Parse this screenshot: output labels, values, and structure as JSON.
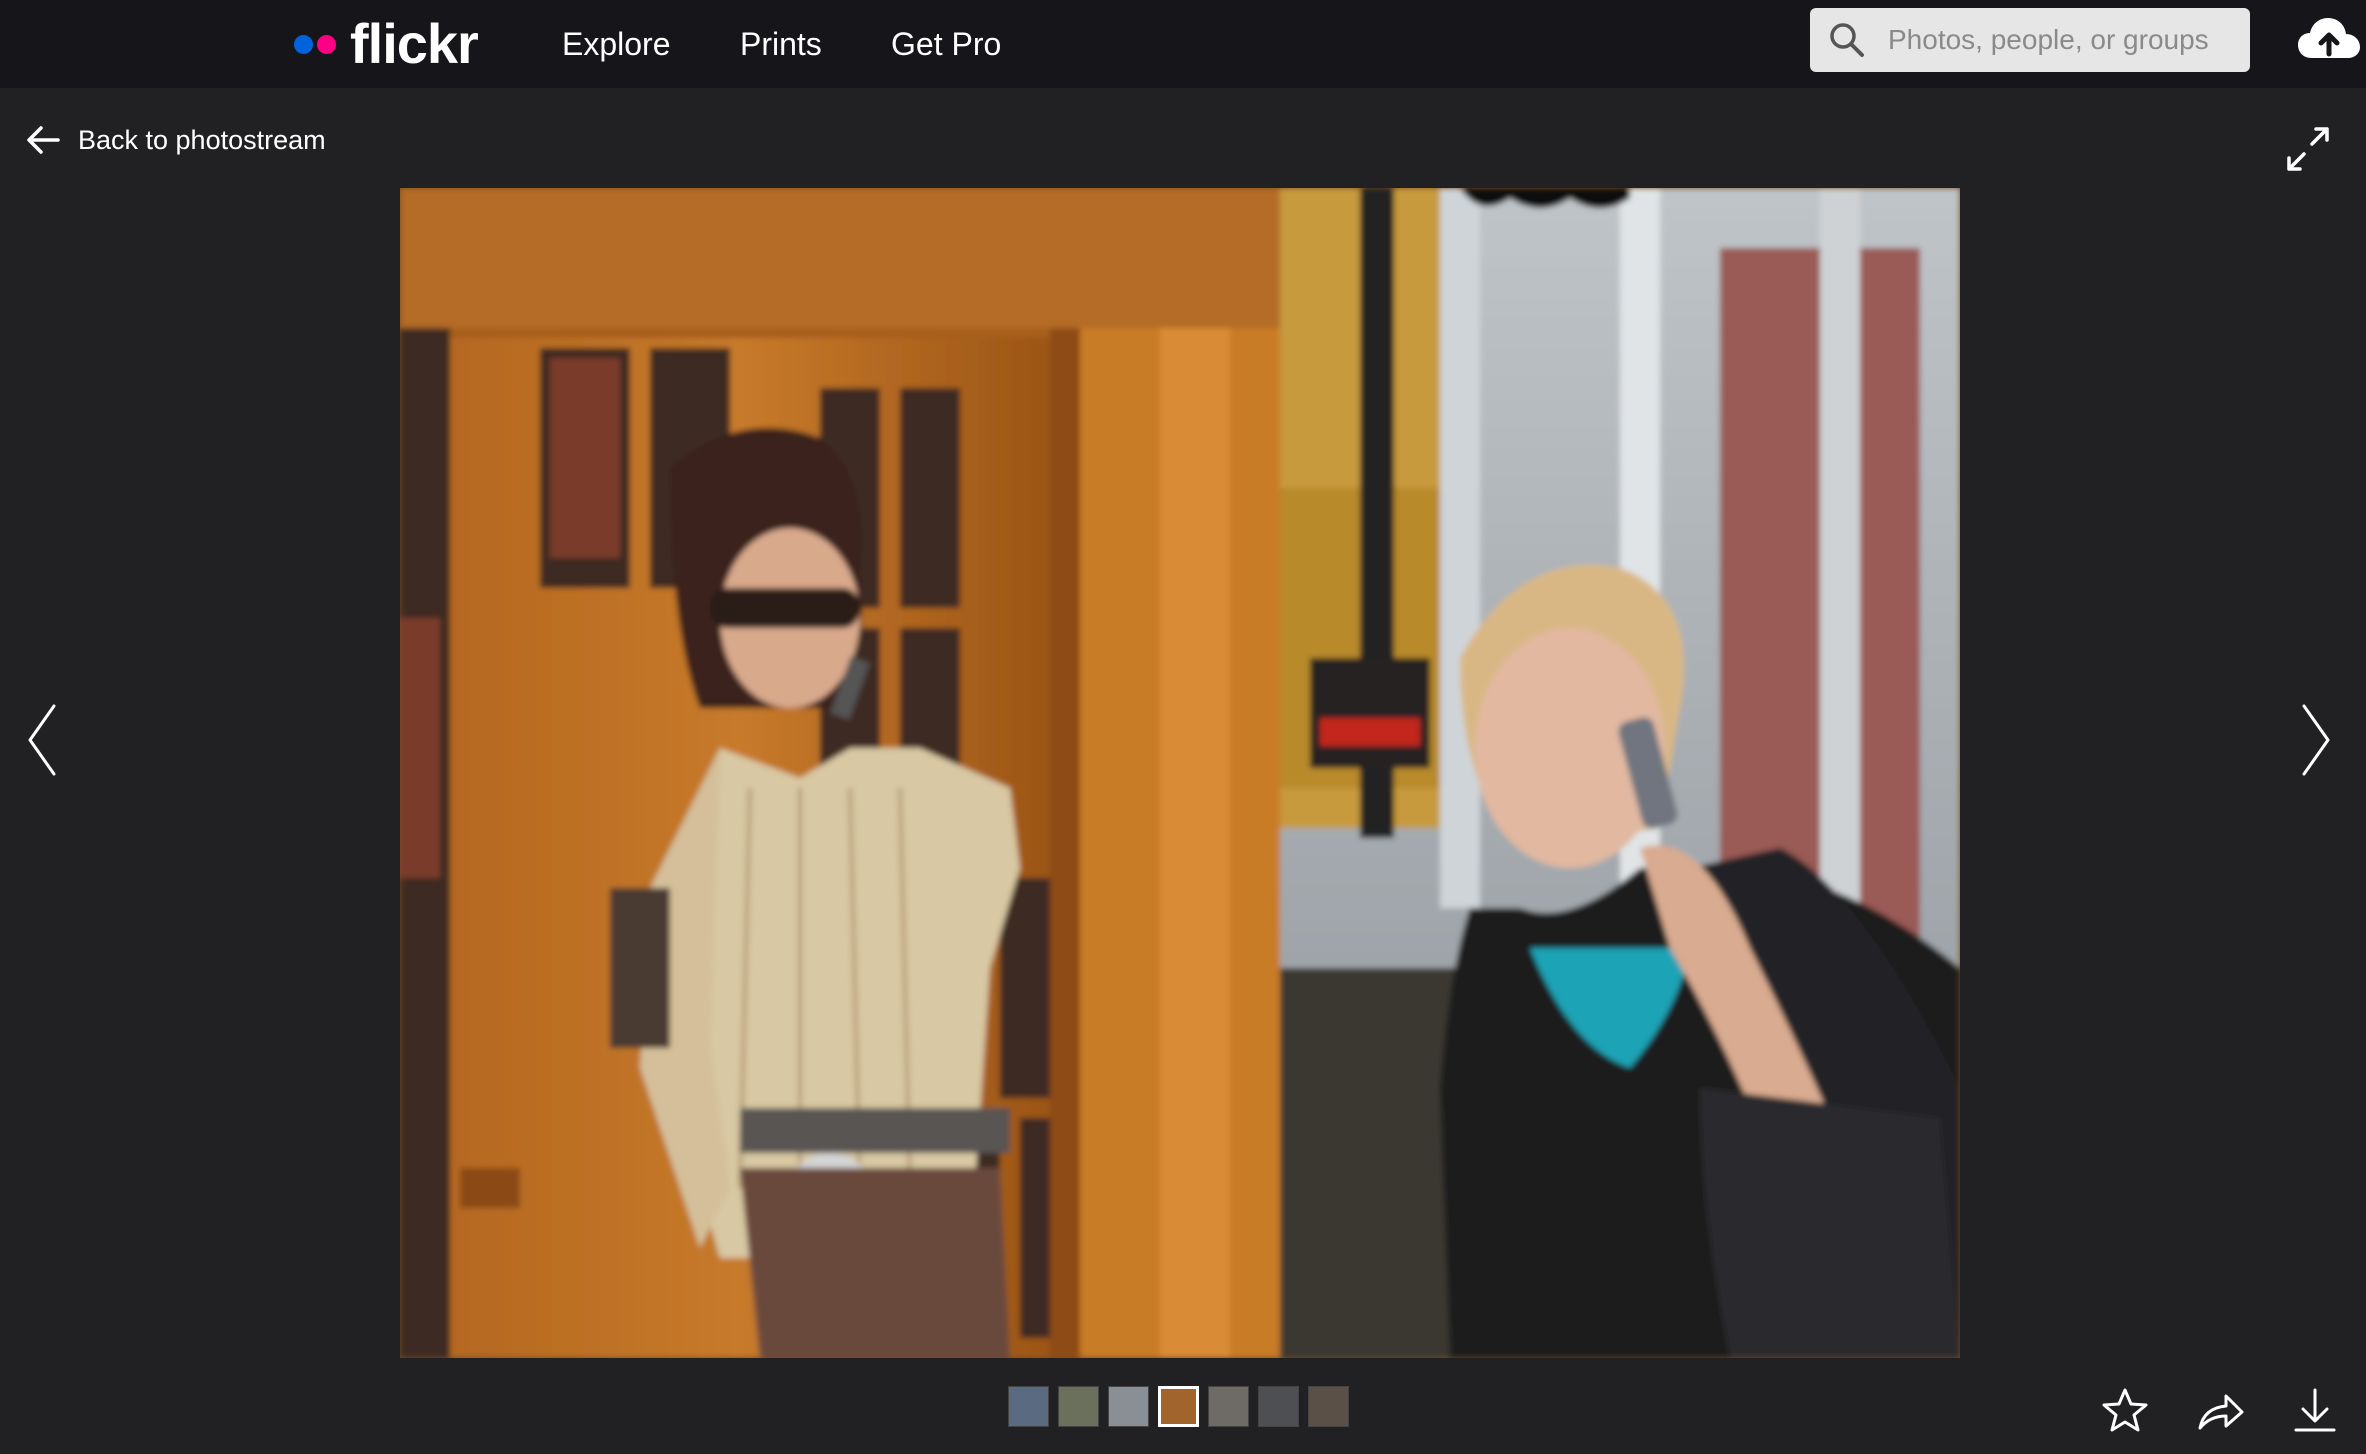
{
  "header": {
    "logo_text": "flickr",
    "logo_colors": {
      "blue": "#0063dc",
      "pink": "#ff0084"
    },
    "nav": [
      {
        "label": "Explore"
      },
      {
        "label": "Prints"
      },
      {
        "label": "Get Pro"
      }
    ],
    "search": {
      "placeholder": "Photos, people, or groups",
      "value": ""
    },
    "upload_icon": "cloud-upload-icon"
  },
  "subheader": {
    "back_label": "Back to photostream",
    "back_icon": "arrow-left-icon",
    "expand_icon": "fullscreen-expand-icon"
  },
  "photo": {
    "description": "",
    "prev_icon": "chevron-left-icon",
    "next_icon": "chevron-right-icon"
  },
  "filmstrip": {
    "count": 7,
    "active_index": 3,
    "thumbnails": [
      {
        "color": "#5a6a80"
      },
      {
        "color": "#6b705c"
      },
      {
        "color": "#8a8f96"
      },
      {
        "color": "#a0642c"
      },
      {
        "color": "#6e6a66"
      },
      {
        "color": "#4e4f52"
      },
      {
        "color": "#5b5048"
      }
    ]
  },
  "actions": [
    {
      "name": "favorite",
      "icon": "star-icon"
    },
    {
      "name": "share",
      "icon": "share-icon"
    },
    {
      "name": "download",
      "icon": "download-icon"
    }
  ]
}
